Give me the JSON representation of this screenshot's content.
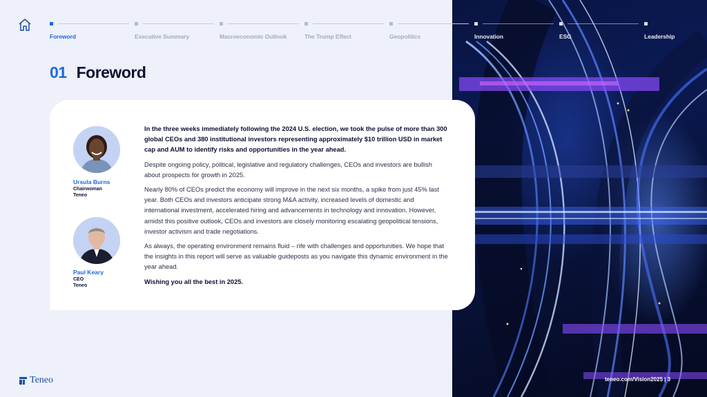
{
  "nav": {
    "items": [
      {
        "label": "Foreword"
      },
      {
        "label": "Executive Summary"
      },
      {
        "label": "Macroeconomic Outlook"
      },
      {
        "label": "The Trump Effect"
      },
      {
        "label": "Geopolitics"
      },
      {
        "label": "Innovation"
      },
      {
        "label": "ESG"
      },
      {
        "label": "Leadership"
      }
    ]
  },
  "section": {
    "number": "01",
    "title": "Foreword"
  },
  "people": [
    {
      "name": "Ursula Burns",
      "role": "Chairwoman",
      "org": "Teneo"
    },
    {
      "name": "Paul Keary",
      "role": "CEO",
      "org": "Teneo"
    }
  ],
  "body": {
    "p1": "In the three weeks immediately following the 2024 U.S. election, we took the pulse of more than 300 global CEOs and 380 institutional investors representing approximately $10 trillion USD in market cap and AUM to identify risks and opportunities in the year ahead.",
    "p2": "Despite ongoing policy, political, legislative and regulatory challenges, CEOs and investors are bullish about prospects for growth in 2025.",
    "p3": "Nearly 80% of CEOs predict the economy will improve in the next six months, a spike from just 45% last year. Both CEOs and investors anticipate strong M&A activity, increased levels of domestic and international investment, accelerated hiring and advancements in technology and innovation. However, amidst this positive outlook, CEOs and investors are closely monitoring escalating geopolitical tensions, investor activism and trade negotiations.",
    "p4": "As always, the operating environment remains fluid – rife with challenges and opportunities. We hope that the insights in this report will serve as valuable guideposts as you navigate this dynamic environment in the year ahead.",
    "p5": "Wishing you all the best in 2025."
  },
  "footer": {
    "logo": "Teneo",
    "url": "teneo.com/Vision2025 | 3"
  },
  "colors": {
    "accent": "#1a6ae0",
    "text": "#0d1130",
    "background": "#eef0fa"
  }
}
